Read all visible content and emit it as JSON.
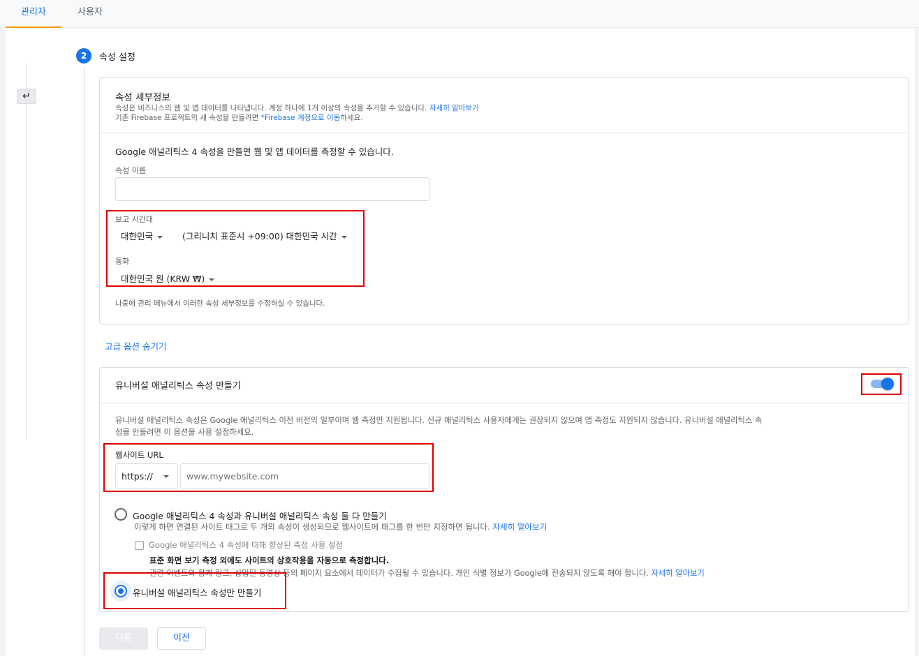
{
  "tabs": [
    {
      "label": "관리자",
      "active": true
    },
    {
      "label": "사용자",
      "active": false
    }
  ],
  "step": {
    "number": "2",
    "title": "속성 설정"
  },
  "property_details": {
    "heading": "속성 세부정보",
    "desc_line1": "속성은 비즈니스의 웹 및 앱 데이터를 나타냅니다. 계정 하나에 1개 이상의 속성을 추가할 수 있습니다.",
    "desc_line1_link": "자세히 알아보기",
    "desc_line2_prefix": "기존 Firebase 프로젝트의 새 속성을 만들려면",
    "desc_line2_link": "*Firebase 계정으로 이동",
    "desc_line2_suffix": "하세요.",
    "ga4_intro": "Google 애널리틱스 4 속성을 만들면 웹 및 앱 데이터를 측정할 수 있습니다.",
    "name_label": "속성 이름",
    "name_value": "",
    "timezone_label": "보고 시간대",
    "timezone_country": "대한민국",
    "timezone_value": "(그리니치 표준시 +09:00) 대한민국 시간",
    "currency_label": "통화",
    "currency_value": "대한민국 원 (KRW ₩)",
    "footnote": "나중에 관리 메뉴에서 이러한 속성 세부정보를 수정하실 수 있습니다."
  },
  "advanced_link": "고급 옵션 숨기기",
  "universal": {
    "heading": "유니버설 애널리틱스 속성 만들기",
    "toggle_on": true,
    "desc_line1": "유니버설 애널리틱스 속성은 Google 애널리틱스 이전 버전의 일부이며 웹 측정만 지원됩니다. 신규 애널리틱스 사용자에게는 권장되지 않으며 앱 측정도 지원되지 않습니다. 유니버설 애널리틱스 속",
    "desc_line2": "성을 만들려면 이 옵션을 사용 설정하세요.",
    "url_label": "웹사이트 URL",
    "protocol_value": "https://",
    "url_placeholder": "www.mywebsite.com",
    "option_both_label": "Google 애널리틱스 4 속성과 유니버설 애널리틱스 속성 둘 다 만들기",
    "option_both_desc": "이렇게 하면 연결된 사이트 태그로 두 개의 속성이 생성되므로 웹사이트에 태그를 한 번만 지정하면 됩니다.",
    "option_both_link": "자세히 알아보기",
    "enhanced_label": "Google 애널리틱스 4 속성에 대해 향상된 측정 사용 설정",
    "enhanced_bold": "표준 화면 보기 측정 외에도 사이트의 상호작용을 자동으로 측정합니다.",
    "enhanced_desc": "관련 이벤트와 함께 링크, 삽입된 동영상 등의 페이지 요소에서 데이터가 수집될 수 있습니다. 개인 식별 정보가 Google에 전송되지 않도록 해야 합니다.",
    "enhanced_link": "자세히 알아보기",
    "option_ua_only_label": "유니버설 애널리틱스 속성만 만들기",
    "selected_option": "ua_only"
  },
  "buttons": {
    "next": "다음",
    "prev": "이전"
  },
  "colors": {
    "accent": "#1a73e8",
    "highlight_box": "#e00000",
    "tab_indicator": "#f29900"
  },
  "icons": {
    "back": "back-arrow-icon",
    "step": "step-number-badge"
  }
}
